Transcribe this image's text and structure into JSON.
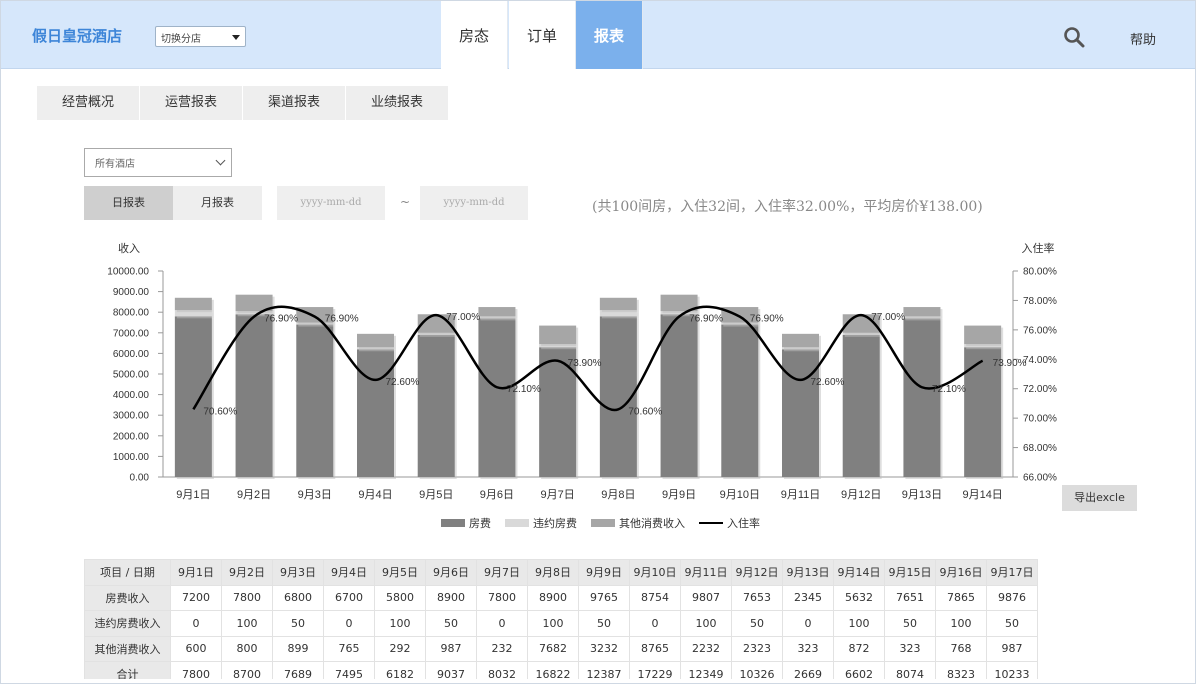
{
  "header": {
    "brand": "假日皇冠酒店",
    "branch_select": "切换分店",
    "tabs": [
      {
        "label": "房态",
        "active": false
      },
      {
        "label": "订单",
        "active": false
      },
      {
        "label": "报表",
        "active": true
      }
    ],
    "search_icon": "search-icon",
    "help": "帮助"
  },
  "subtabs": [
    "经营概况",
    "运营报表",
    "渠道报表",
    "业绩报表"
  ],
  "filters": {
    "hotel_select": "所有酒店",
    "periods": [
      {
        "label": "日报表",
        "active": true
      },
      {
        "label": "月报表",
        "active": false
      }
    ],
    "start_placeholder": "yyyy-mm-dd",
    "tilde": "~",
    "end_placeholder": "yyyy-mm-dd",
    "summary": "(共100间房，入住32间，入住率32.00%，平均房价¥138.00)"
  },
  "colors": {
    "header_bg": "#d6e7fb",
    "brand": "#3d85d8",
    "active_tab": "#7bb0ec",
    "room_fee": "#808080",
    "breach_fee": "#d9d9d9",
    "other_income": "#a6a6a6",
    "occupancy_line": "#000000"
  },
  "chart_data": {
    "type": "bar",
    "categories": [
      "9月1日",
      "9月2日",
      "9月3日",
      "9月4日",
      "9月5日",
      "9月6日",
      "9月7日",
      "9月8日",
      "9月9日",
      "9月10日",
      "9月11日",
      "9月12日",
      "9月13日",
      "9月14日"
    ],
    "series": [
      {
        "name": "房费",
        "type": "bar",
        "axis": "left",
        "color": "#808080",
        "values": [
          7800,
          7900,
          7400,
          6200,
          6900,
          7700,
          6300,
          7800,
          7900,
          7400,
          6200,
          6900,
          7700,
          6300
        ]
      },
      {
        "name": "违约房费",
        "type": "bar",
        "axis": "left",
        "color": "#d9d9d9",
        "values": [
          300,
          150,
          100,
          100,
          100,
          100,
          150,
          300,
          150,
          100,
          100,
          100,
          100,
          150
        ]
      },
      {
        "name": "其他消费收入",
        "type": "bar",
        "axis": "left",
        "color": "#a6a6a6",
        "values": [
          600,
          800,
          750,
          650,
          900,
          450,
          900,
          600,
          800,
          750,
          650,
          900,
          450,
          900
        ]
      },
      {
        "name": "入住率",
        "type": "line",
        "axis": "right",
        "color": "#000000",
        "values": [
          70.6,
          76.9,
          76.9,
          72.6,
          77.0,
          72.1,
          73.9,
          70.6,
          76.9,
          76.9,
          72.6,
          77.0,
          72.1,
          73.9
        ],
        "labels": [
          "70.60%",
          "76.90%",
          "76.90%",
          "72.60%",
          "77.00%",
          "72.10%",
          "73.90%",
          "70.60%",
          "76.90%",
          "76.90%",
          "72.60%",
          "77.00%",
          "72.10%",
          "73.90%"
        ]
      }
    ],
    "ylabel_left": "收入",
    "ylabel_right": "入住率",
    "ylim_left": [
      0,
      10000
    ],
    "yticks_left": [
      "10000.00",
      "9000.00",
      "8000.00",
      "7000.00",
      "6000.00",
      "5000.00",
      "4000.00",
      "3000.00",
      "2000.00",
      "1000.00",
      "0.00"
    ],
    "ylim_right": [
      66,
      80
    ],
    "yticks_right": [
      "80.00%",
      "78.00%",
      "76.00%",
      "74.00%",
      "72.00%",
      "70.00%",
      "68.00%",
      "66.00%"
    ],
    "legend_position": "bottom",
    "grid": false
  },
  "export_label": "导出excle",
  "table": {
    "headers": [
      "项目 / 日期",
      "9月1日",
      "9月2日",
      "9月3日",
      "9月4日",
      "9月5日",
      "9月6日",
      "9月7日",
      "9月8日",
      "9月9日",
      "9月10日",
      "9月11日",
      "9月12日",
      "9月13日",
      "9月14日",
      "9月15日",
      "9月16日",
      "9月17日"
    ],
    "rows": [
      {
        "label": "房费收入",
        "values": [
          "7200",
          "7800",
          "6800",
          "6700",
          "5800",
          "8900",
          "7800",
          "8900",
          "9765",
          "8754",
          "9807",
          "7653",
          "2345",
          "5632",
          "7651",
          "7865",
          "9876"
        ]
      },
      {
        "label": "违约房费收入",
        "values": [
          "0",
          "100",
          "50",
          "0",
          "100",
          "50",
          "0",
          "100",
          "50",
          "0",
          "100",
          "50",
          "0",
          "100",
          "50",
          "100",
          "50"
        ]
      },
      {
        "label": "其他消费收入",
        "values": [
          "600",
          "800",
          "899",
          "765",
          "292",
          "987",
          "232",
          "7682",
          "3232",
          "8765",
          "2232",
          "2323",
          "323",
          "872",
          "323",
          "768",
          "987"
        ]
      },
      {
        "label": "合计",
        "values": [
          "7800",
          "8700",
          "7689",
          "7495",
          "6182",
          "9037",
          "8032",
          "16822",
          "12387",
          "17229",
          "12349",
          "10326",
          "2669",
          "6602",
          "8074",
          "8323",
          "10233"
        ]
      }
    ]
  }
}
